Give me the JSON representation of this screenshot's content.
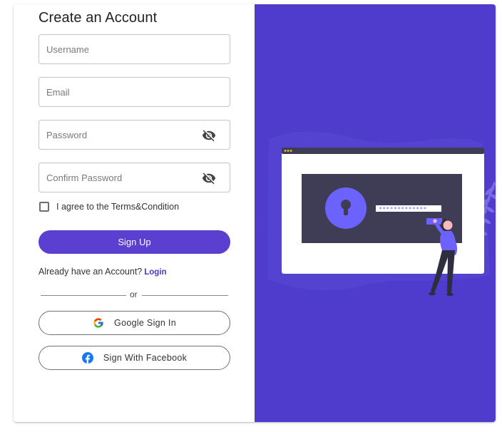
{
  "form": {
    "title": "Create an Account",
    "username_placeholder": "Username",
    "email_placeholder": "Email",
    "password_placeholder": "Password",
    "confirm_password_placeholder": "Confirm Password",
    "terms_label": "I agree to the Terms&Condition",
    "signup_label": "Sign Up",
    "already_text": "Already have an Account?",
    "login_label": "Login",
    "or_text": "or",
    "google_label": "Google Sign In",
    "facebook_label": "Sign With Facebook"
  },
  "icons": {
    "eye": "eye-off-icon",
    "google": "google-icon",
    "facebook": "facebook-icon",
    "lock": "keyhole-icon"
  },
  "colors": {
    "accent": "#5a3fd1",
    "panel": "#4f3ccd",
    "link": "#4a35c8"
  },
  "illustration": {
    "password_mask": "*************"
  }
}
